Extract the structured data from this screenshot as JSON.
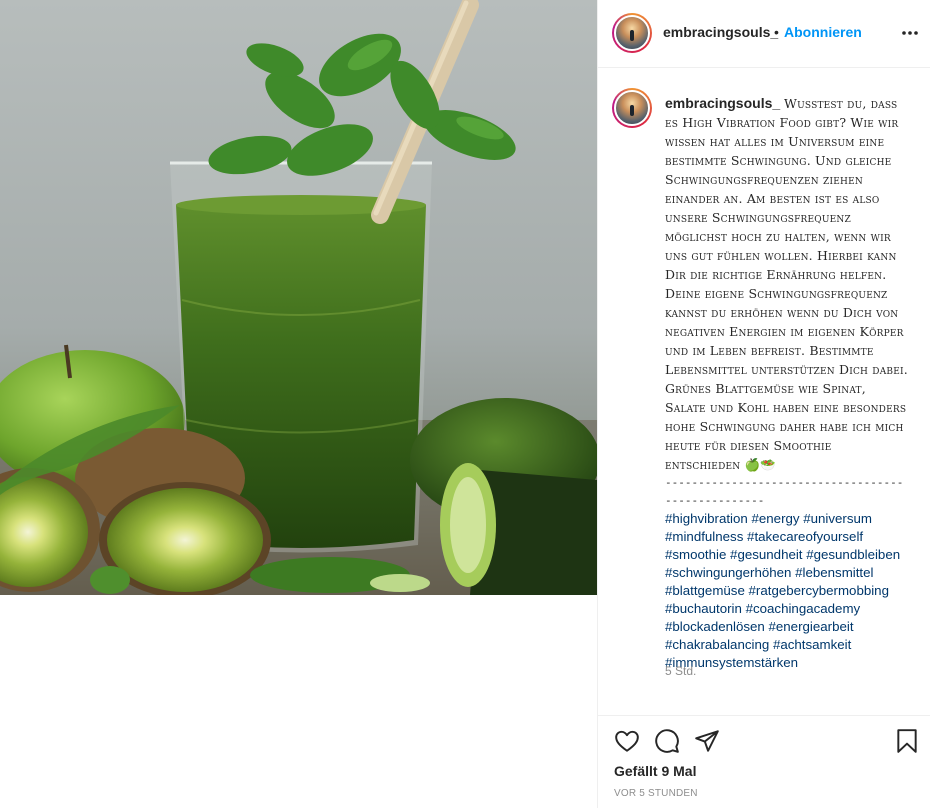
{
  "header": {
    "username": "embracingsouls_",
    "separator": "•",
    "follow_label": "Abonnieren",
    "more_icon": "more-dots-icon"
  },
  "photo": {
    "subject": "green smoothie glass with mint, straw, kiwi, apple, cucumber",
    "alt_colors": {
      "background": "#aab1b1",
      "smoothie": "#3f6e1e",
      "kiwi": "#8aa33a"
    }
  },
  "caption": {
    "username": "embracingsouls_",
    "text": "Wusstest du, dass es High Vibration Food gibt? Wie wir wissen hat alles im Universum eine bestimmte Schwingung. Und gleiche Schwingungsfrequenzen ziehen einander an. Am besten ist es also unsere Schwingungsfrequenz möglichst hoch zu halten, wenn wir uns gut fühlen wollen. Hierbei kann Dir die richtige Ernährung helfen. Deine eigene Schwingungsfrequenz kannst du erhöhen wenn du Dich von negativen Energien im eigenen Körper und im Leben befreist. Bestimmte Lebensmittel unterstützen Dich dabei. Grünes Blattgemüse wie Spinat, Salate und Kohl haben eine besonders hohe Schwingung daher habe ich mich heute für diesen Smoothie entschieden 🍏🥗",
    "divider": "---------------------------------------------------",
    "hashtags": [
      "#highvibration",
      "#energy",
      "#universum",
      "#mindfulness",
      "#takecareofyourself",
      "#smoothie",
      "#gesundheit",
      "#gesundbleiben",
      "#schwingungerhöhen",
      "#lebensmittel",
      "#blattgemüse",
      "#ratgebercybermobbing",
      "#buchautorin",
      "#coachingacademy",
      "#blockadenlösen",
      "#energiearbeit",
      "#chakrabalancing",
      "#achtsamkeit",
      "#immunsystemstärken"
    ],
    "age": "5 Std."
  },
  "actions": {
    "like_icon": "heart-icon",
    "comment_icon": "comment-icon",
    "share_icon": "paper-plane-icon",
    "save_icon": "bookmark-icon",
    "likes_text": "Gefällt 9 Mal",
    "timestamp": "vor 5 Stunden"
  },
  "colors": {
    "link_blue": "#0095f6",
    "hashtag": "#00376b",
    "muted": "#8e8e8e",
    "border": "#efefef"
  }
}
